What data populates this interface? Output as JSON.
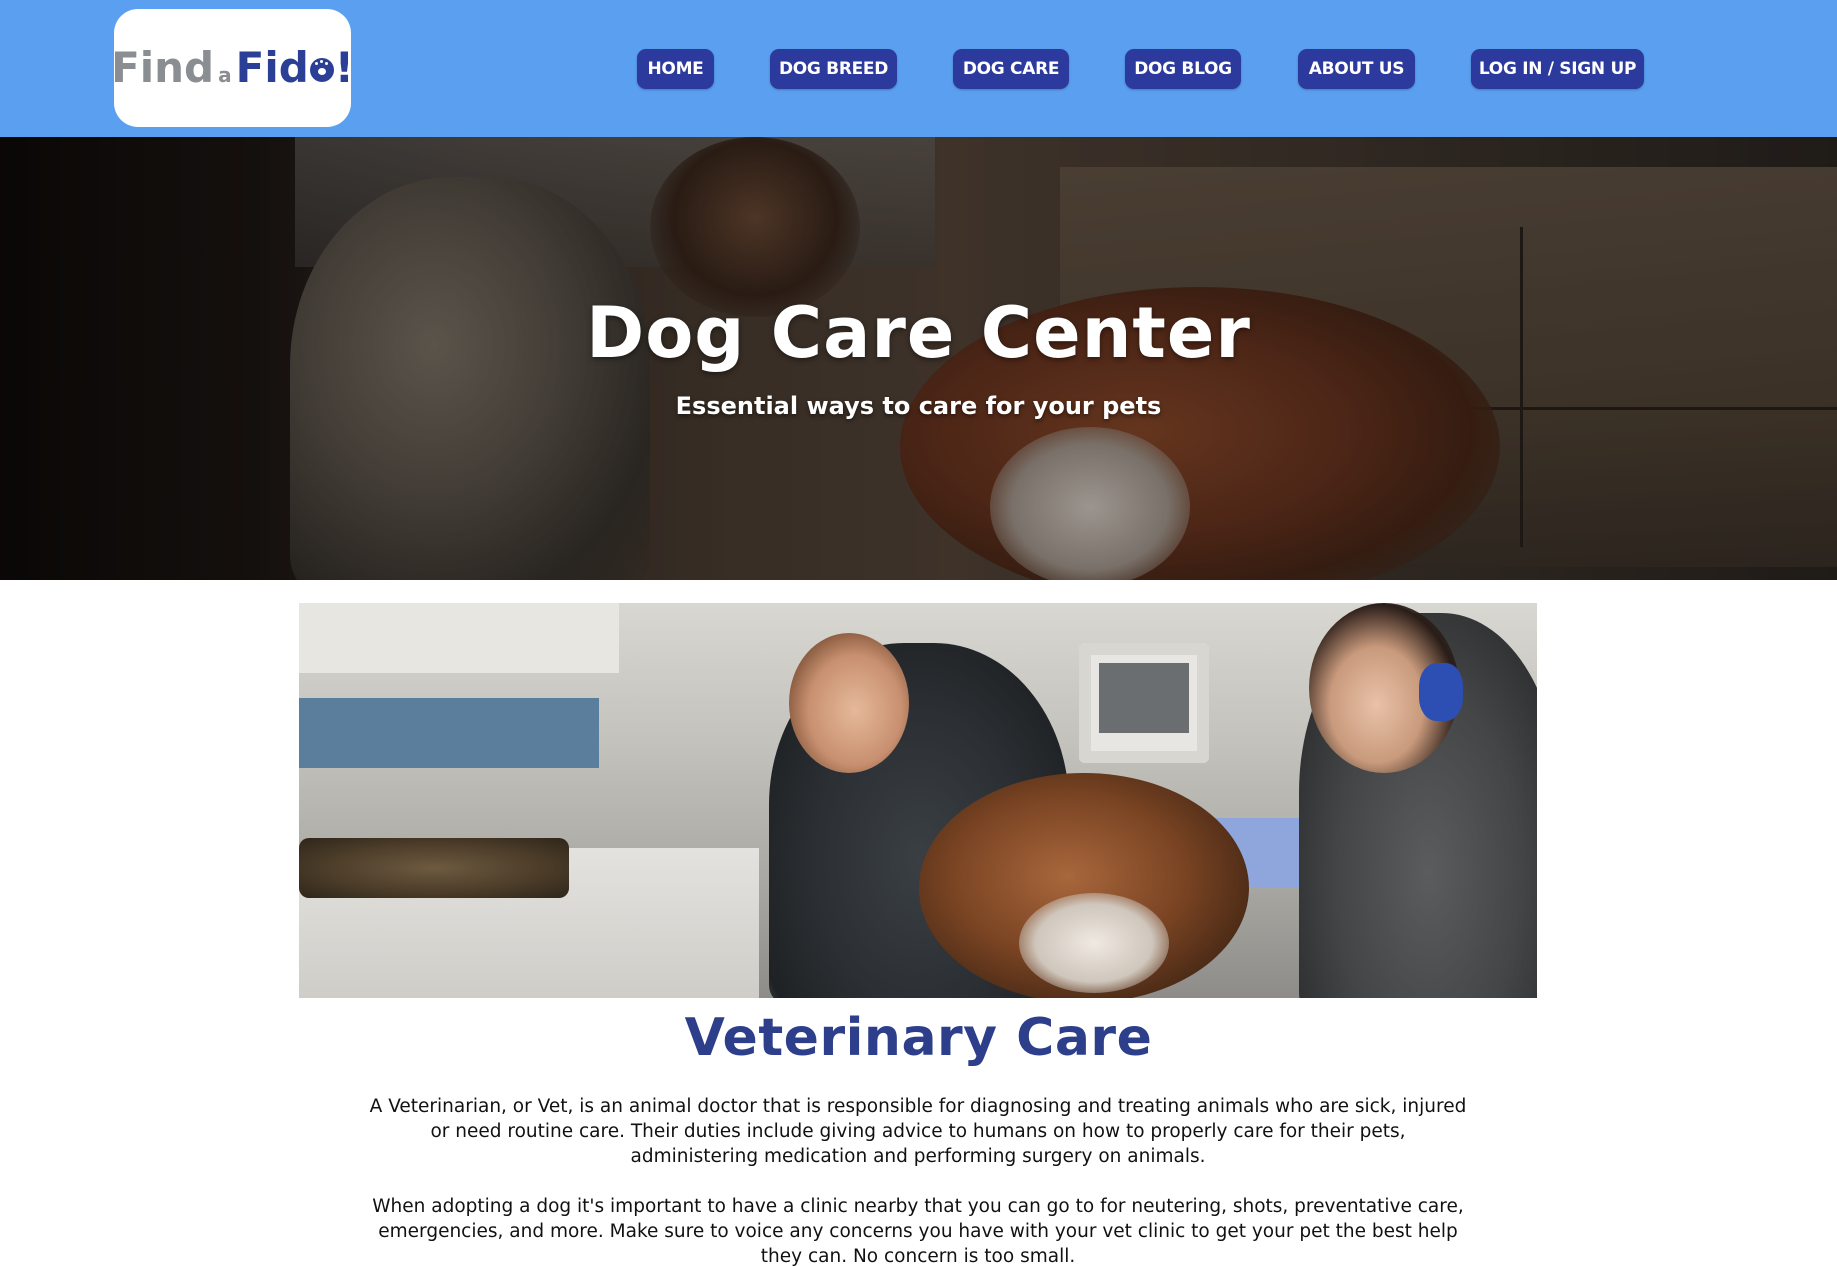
{
  "header": {
    "logo": {
      "find": "Find",
      "a": "a",
      "fido_prefix": "Fid",
      "fido_suffix": "!"
    },
    "nav": [
      {
        "label": "HOME"
      },
      {
        "label": "DOG BREED"
      },
      {
        "label": "DOG CARE"
      },
      {
        "label": "DOG BLOG"
      },
      {
        "label": "ABOUT US"
      },
      {
        "label": "LOG IN / SIGN UP"
      }
    ]
  },
  "hero": {
    "title": "Dog Care Center",
    "subtitle": "Essential ways to care for your pets"
  },
  "section": {
    "title": "Veterinary Care",
    "paragraphs": [
      "A Veterinarian, or Vet, is an animal doctor that is responsible for diagnosing and treating animals who are sick, injured or need routine care. Their duties include giving advice to humans on how to properly care for their pets, administering medication and performing surgery on animals.",
      "When adopting a dog it's important to have a clinic nearby that you can go to for neutering, shots, preventative care, emergencies, and more. Make sure to voice any concerns you have with your vet clinic to get your pet the best help they can. No concern is too small."
    ]
  },
  "colors": {
    "header_bg": "#5b9ff0",
    "nav_button_bg": "#2b3a9c",
    "logo_grey": "#8a8d91",
    "logo_navy": "#2b3f96",
    "section_title": "#2d3e8a"
  }
}
